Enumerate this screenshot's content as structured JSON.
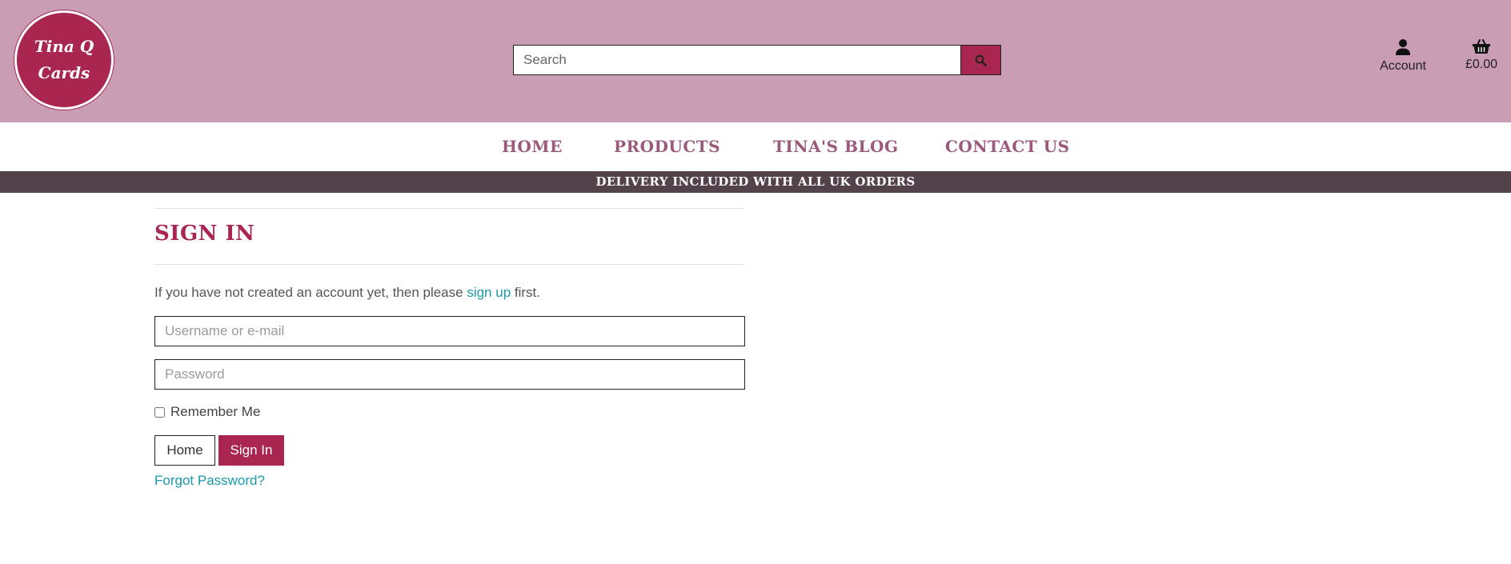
{
  "header": {
    "logo_line1": "Tina Q",
    "logo_line2": "Cards",
    "search": {
      "placeholder": "Search",
      "value": ""
    },
    "account_label": "Account",
    "cart_total": "£0.00"
  },
  "nav": {
    "items": [
      {
        "label": "HOME"
      },
      {
        "label": "PRODUCTS"
      },
      {
        "label": "TINA'S BLOG"
      },
      {
        "label": "CONTACT US"
      }
    ]
  },
  "banner": {
    "text": "DELIVERY INCLUDED WITH ALL UK ORDERS"
  },
  "main": {
    "title": "SIGN IN",
    "intro_prefix": "If you have not created an account yet, then please ",
    "intro_link": "sign up",
    "intro_suffix": " first.",
    "username_placeholder": "Username or e-mail",
    "password_placeholder": "Password",
    "remember_label": "Remember Me",
    "home_button": "Home",
    "signin_button": "Sign In",
    "forgot_link": "Forgot Password?"
  },
  "icons": {
    "search": "search-icon",
    "account": "user-icon",
    "cart": "basket-icon"
  },
  "colors": {
    "header_bg": "#c99db3",
    "brand": "#a8264f",
    "nav_text": "#9b5a7c",
    "banner_bg": "#54424b",
    "link": "#1a9aaa"
  }
}
